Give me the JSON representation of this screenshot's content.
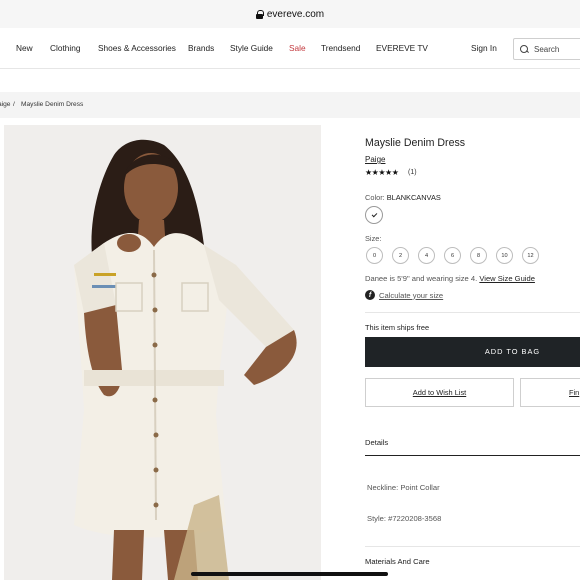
{
  "browser": {
    "url": "evereve.com"
  },
  "nav": {
    "items": [
      "New",
      "Clothing",
      "Shoes & Accessories",
      "Brands",
      "Style Guide",
      "Sale",
      "Trendsend",
      "EVEREVE TV"
    ],
    "sign_in": "Sign In",
    "search_placeholder": "Search"
  },
  "breadcrumb": {
    "first": "aige",
    "separator": "/",
    "current": "Mayslie Denim Dress"
  },
  "product": {
    "title": "Mayslie Denim Dress",
    "brand": "Paige",
    "rating_stars": "★★★★★",
    "rating_value": 5,
    "review_count": "(1)",
    "color_label": "Color:",
    "color_value": "BLANKCANVAS",
    "size_label": "Size:",
    "sizes": [
      "0",
      "2",
      "4",
      "6",
      "8",
      "10",
      "12"
    ],
    "fit_note": "Danee is 5'9\" and wearing size 4.",
    "size_guide_link": "View Size Guide",
    "calc_size_link": "Calculate your size",
    "calc_icon_glyph": "f",
    "ships_note": "This item ships free",
    "add_to_bag": "ADD TO BAG",
    "wishlist": "Add to Wish List",
    "find_in_store": "Fin",
    "details_tab": "Details",
    "neckline": "Neckline: Point Collar",
    "style_number": "Style: #7220208-3568",
    "materials_tab": "Materials And Care"
  },
  "colors": {
    "add_bag_bg": "#1f2326",
    "sale": "#c2383d",
    "photo_bg": "#f0eeec",
    "dress": "#f3efe6",
    "skin": "#8a5a3c",
    "hair": "#2b1d16"
  }
}
